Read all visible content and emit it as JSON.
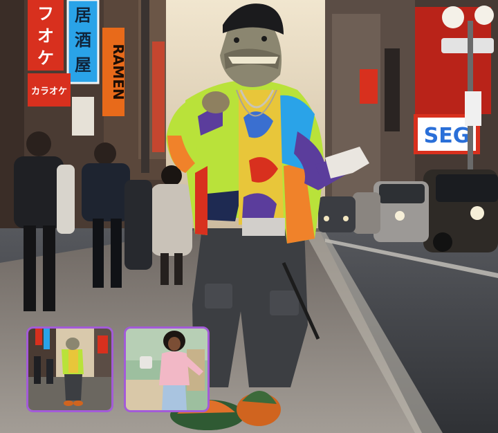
{
  "scene": {
    "signs": {
      "katakana_sign": [
        "フ",
        "オ",
        "ケ"
      ],
      "izakaya_sign": [
        "居",
        "酒",
        "屋"
      ],
      "ramen_sign": "RAMEN",
      "karaoke_sign": "カラオケ",
      "sega_sign": "SEG"
    },
    "colors": {
      "sky": "#e9dcc4",
      "road": "#3e4045",
      "sidewalk": "#8e8a86",
      "sign_red": "#d8301e",
      "sign_blue": "#2aa3e8",
      "jacket_green": "#b9e23a",
      "jacket_orange": "#f0822a",
      "jacket_purple": "#5b3d9c",
      "pants": "#3c3e42",
      "thumb_border": "#a35bd8"
    }
  },
  "thumbnails": [
    {
      "subject": "costumed-dancer-street-thumbnail"
    },
    {
      "subject": "woman-dancing-indoors-thumbnail"
    }
  ]
}
